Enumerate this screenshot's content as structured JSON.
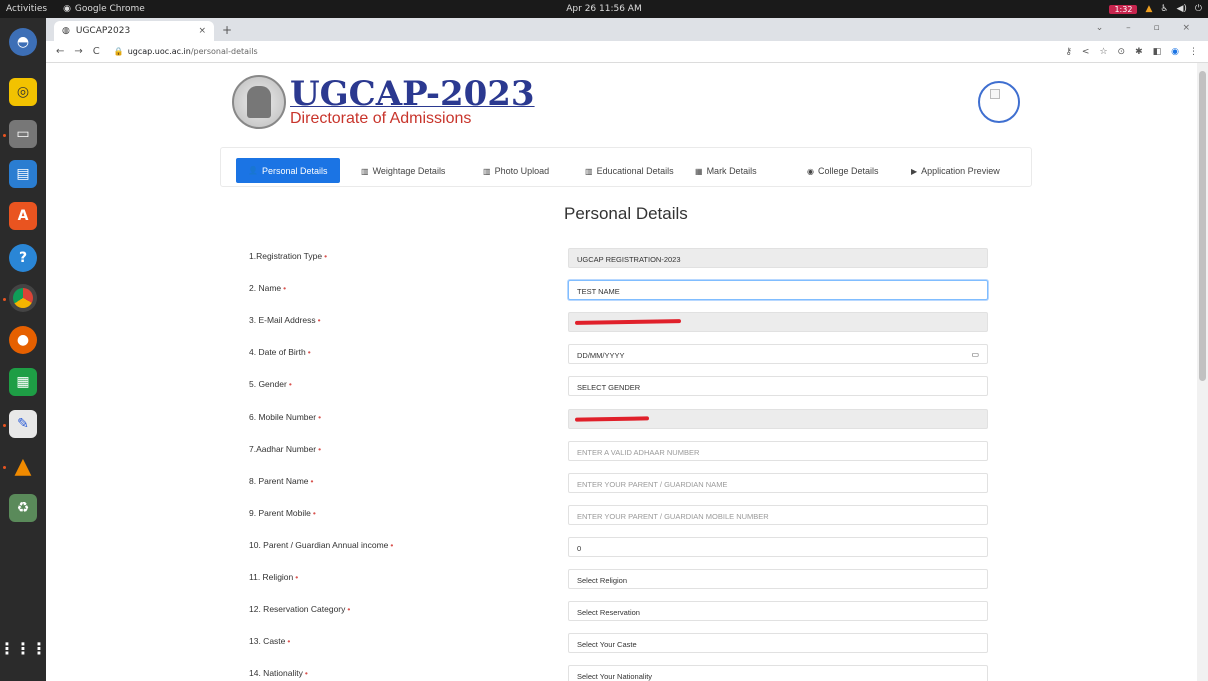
{
  "topbar": {
    "activities": "Activities",
    "app_name": "Google Chrome",
    "clock": "Apr 26  11:56 AM",
    "record_badge": "1:32"
  },
  "browser": {
    "tab_title": "UGCAP2023",
    "url_host": "ugcap.uoc.ac.in",
    "url_path": "/personal-details"
  },
  "header": {
    "logo_title": "UGCAP-2023",
    "logo_subtitle": "Directorate of Admissions"
  },
  "steps": [
    {
      "label": "Personal Details",
      "icon": "user-icon"
    },
    {
      "label": "Weightage Details",
      "icon": "table-icon"
    },
    {
      "label": "Photo Upload",
      "icon": "image-icon"
    },
    {
      "label": "Educational Details",
      "icon": "book-icon"
    },
    {
      "label": "Mark Details",
      "icon": "grid-icon"
    },
    {
      "label": "College Details",
      "icon": "target-icon"
    },
    {
      "label": "Application Preview",
      "icon": "preview-icon"
    }
  ],
  "form": {
    "title": "Personal Details",
    "fields": [
      {
        "label": "1.Registration Type",
        "value": "UGCAP REGISTRATION-2023",
        "kind": "gray"
      },
      {
        "label": "2. Name",
        "value": "TEST NAME",
        "kind": "focus"
      },
      {
        "label": "3. E-Mail Address",
        "value": "",
        "kind": "gray"
      },
      {
        "label": "4. Date of Birth",
        "value": "DD/MM/YYYY",
        "kind": "date"
      },
      {
        "label": "5. Gender",
        "value": "SELECT GENDER",
        "kind": "select"
      },
      {
        "label": "6. Mobile Number",
        "value": "",
        "kind": "gray"
      },
      {
        "label": "7.Aadhar Number",
        "value": "ENTER A VALID ADHAAR NUMBER",
        "kind": "placeholder"
      },
      {
        "label": "8. Parent Name",
        "value": "ENTER YOUR PARENT / GUARDIAN NAME",
        "kind": "placeholder"
      },
      {
        "label": "9. Parent Mobile",
        "value": "ENTER YOUR PARENT / GUARDIAN MOBILE NUMBER",
        "kind": "placeholder"
      },
      {
        "label": "10. Parent / Guardian Annual income",
        "value": "0",
        "kind": "text"
      },
      {
        "label": "11. Religion",
        "value": "Select Religion",
        "kind": "select"
      },
      {
        "label": "12. Reservation Category",
        "value": "Select Reservation",
        "kind": "select"
      },
      {
        "label": "13. Caste",
        "value": "Select Your Caste",
        "kind": "select"
      },
      {
        "label": "14. Nationality",
        "value": "Select Your Nationality",
        "kind": "select"
      }
    ]
  },
  "colors": {
    "primary": "#1b74e4",
    "logo_blue": "#2b3990",
    "logo_red": "#c8352c",
    "required": "#d9534f",
    "redaction": "#e0202a"
  }
}
